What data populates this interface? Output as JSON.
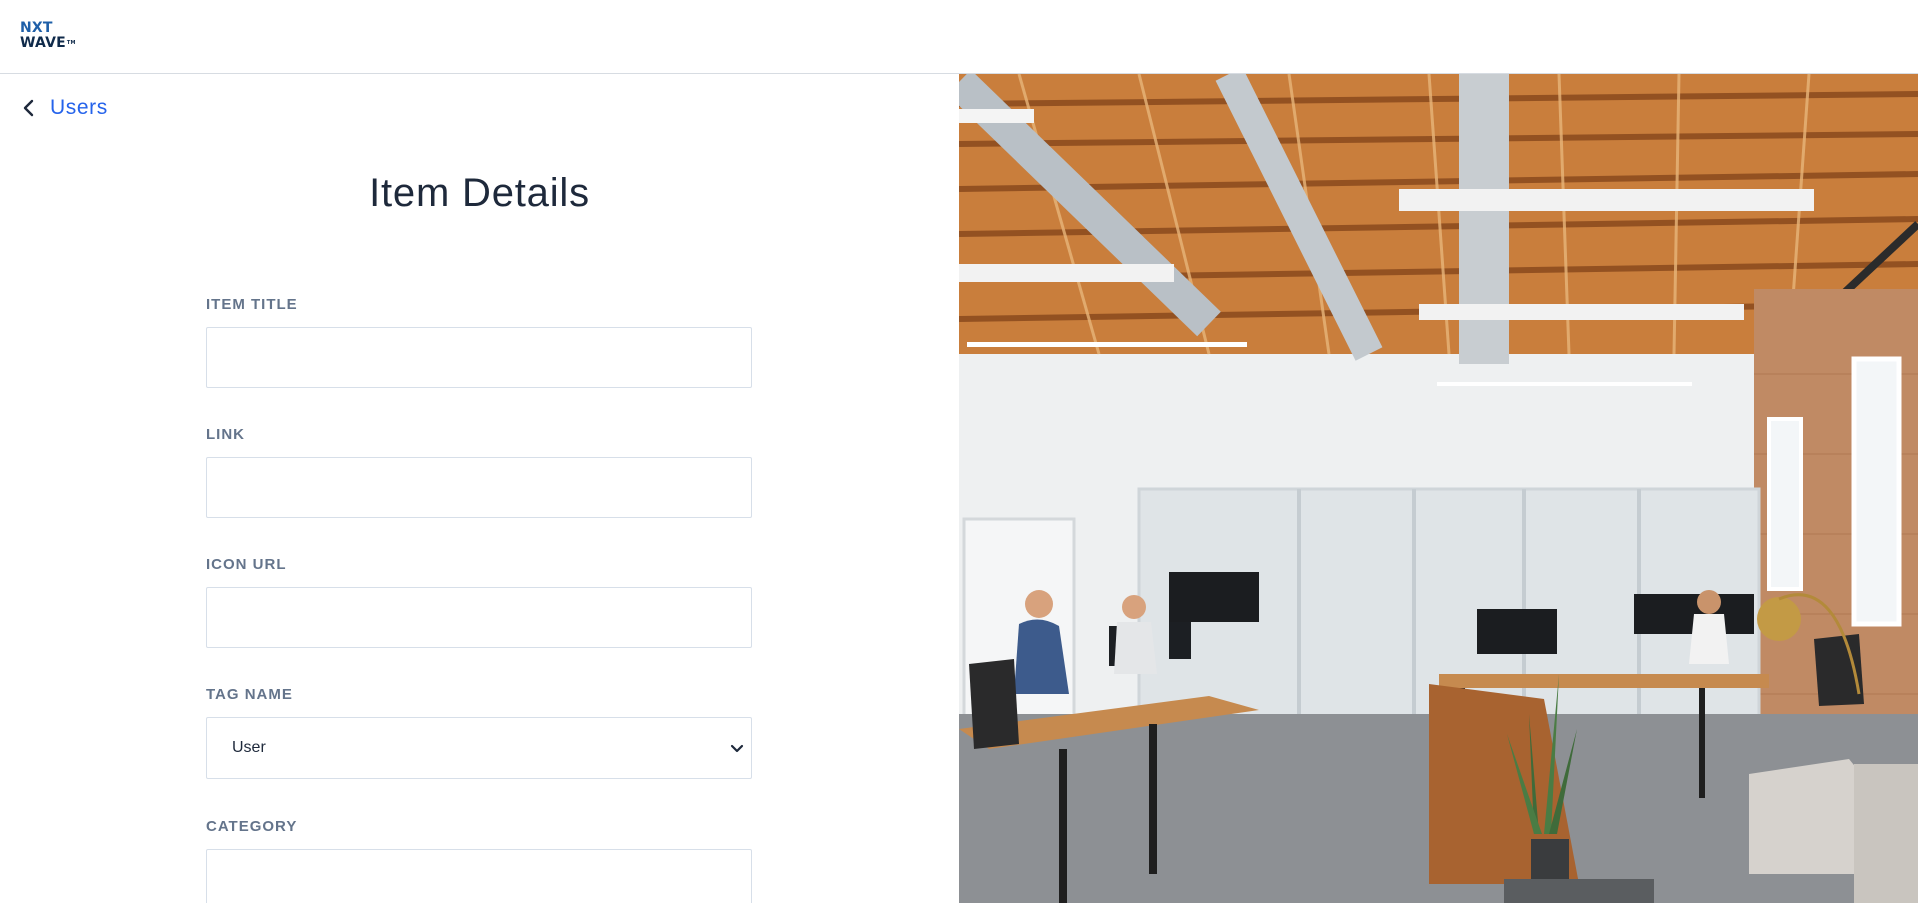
{
  "brand": {
    "logo_line1": "NXT",
    "logo_line2": "WAVE",
    "logo_mark": "TM"
  },
  "nav": {
    "back_label": "Users",
    "back_icon": "chevron-left-icon"
  },
  "page": {
    "title": "Item Details"
  },
  "form": {
    "item_title": {
      "label": "ITEM TITLE",
      "value": "",
      "placeholder": ""
    },
    "link": {
      "label": "LINK",
      "value": "",
      "placeholder": ""
    },
    "icon_url": {
      "label": "ICON URL",
      "value": "",
      "placeholder": ""
    },
    "tag_name": {
      "label": "TAG NAME",
      "selected": "User",
      "icon": "chevron-down-icon"
    },
    "category": {
      "label": "CATEGORY",
      "value": "",
      "placeholder": ""
    }
  },
  "colors": {
    "accent": "#2563eb",
    "title": "#1e293b",
    "label": "#64748b",
    "border": "#d7dfe9"
  }
}
